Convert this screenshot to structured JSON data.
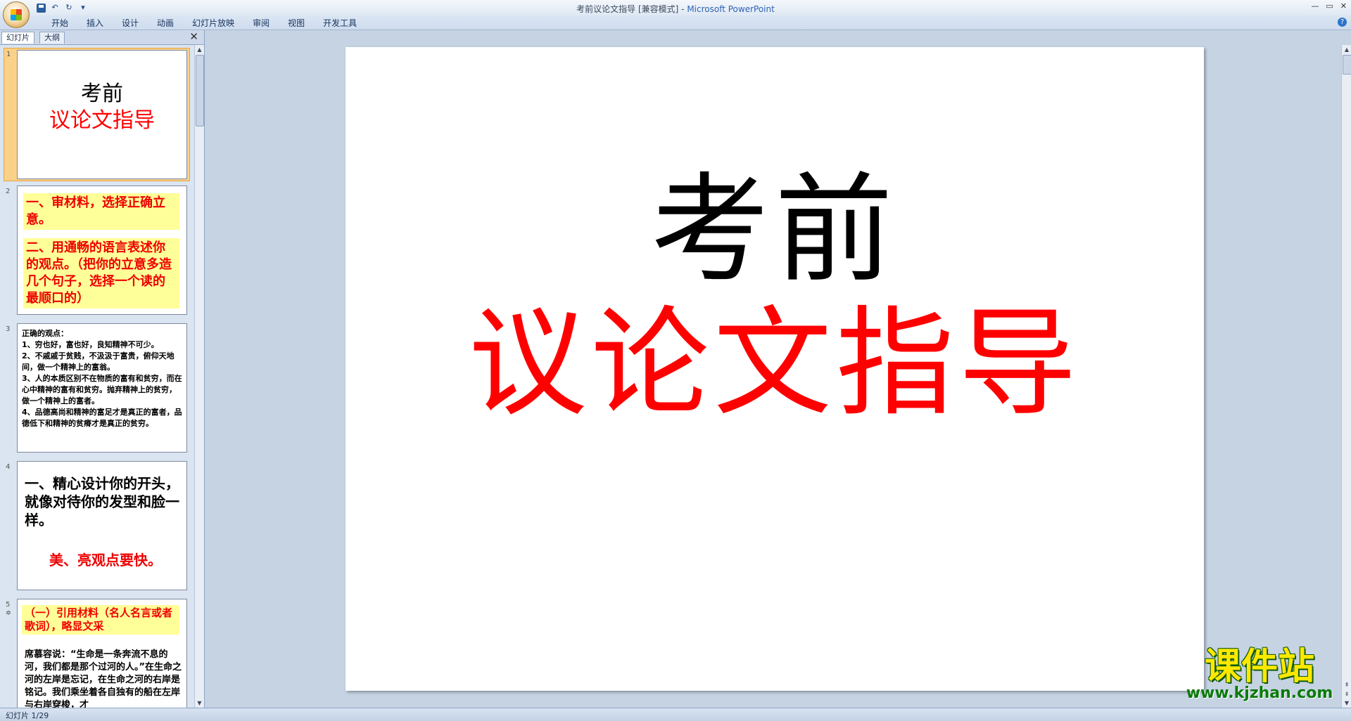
{
  "window": {
    "title_doc": "考前议论文指导 [兼容模式]",
    "title_sep": " - ",
    "title_app": "Microsoft PowerPoint",
    "minimize": "—",
    "maximize": "▭",
    "close": "✕"
  },
  "quick_access": {
    "undo": "↶",
    "redo": "↻",
    "customize": "▾"
  },
  "ribbon": {
    "tabs": [
      "开始",
      "插入",
      "设计",
      "动画",
      "幻灯片放映",
      "审阅",
      "视图",
      "开发工具"
    ],
    "help": "?"
  },
  "left_pane": {
    "tabs": [
      "幻灯片",
      "大纲"
    ],
    "close": "✕",
    "thumbnails": [
      {
        "number": "1",
        "line1": "考前",
        "line2": "议论文指导"
      },
      {
        "number": "2",
        "block1": "一、审材料，选择正确立意。",
        "block2": "二、用通畅的语言表述你的观点。（把你的立意多造几个句子，选择一个读的最顺口的）"
      },
      {
        "number": "3",
        "text": "正确的观点：\n1、穷也好，富也好，良知精神不可少。\n2、不戚戚于贫贱，不汲汲于富贵，俯仰天地间，做一个精神上的富翁。\n3、人的本质区别不在物质的富有和贫穷，而在心中精神的富有和贫穷。抛弃精神上的贫穷，做一个精神上的富者。\n4、品德高尚和精神的富足才是真正的富者，品德低下和精神的贫瘠才是真正的贫穷。"
      },
      {
        "number": "4",
        "line1": "一、精心设计你的开头，就像对待你的发型和脸一样。",
        "line2": "美、亮观点要快。"
      },
      {
        "number": "5",
        "sub": "✲",
        "header": "（一）引用材料（名人名言或者歌词），略显文采",
        "body": "席慕容说：“生命是一条奔流不息的河，我们都是那个过河的人。”在生命之河的左岸是忘记，在生命之河的右岸是铭记。我们乘坐着各自独有的船在左岸与右岸穿梭，才"
      }
    ]
  },
  "slide": {
    "title": "考前",
    "subtitle": "议论文指导"
  },
  "watermark": {
    "text": "课件站",
    "url": "www.kjzhan.com"
  },
  "status": {
    "slide_indicator": "幻灯片 1/29"
  },
  "colors": {
    "title_red": "#ff0000",
    "highlight_yellow": "#ffff99",
    "workspace_bg": "#c6d3e3"
  }
}
